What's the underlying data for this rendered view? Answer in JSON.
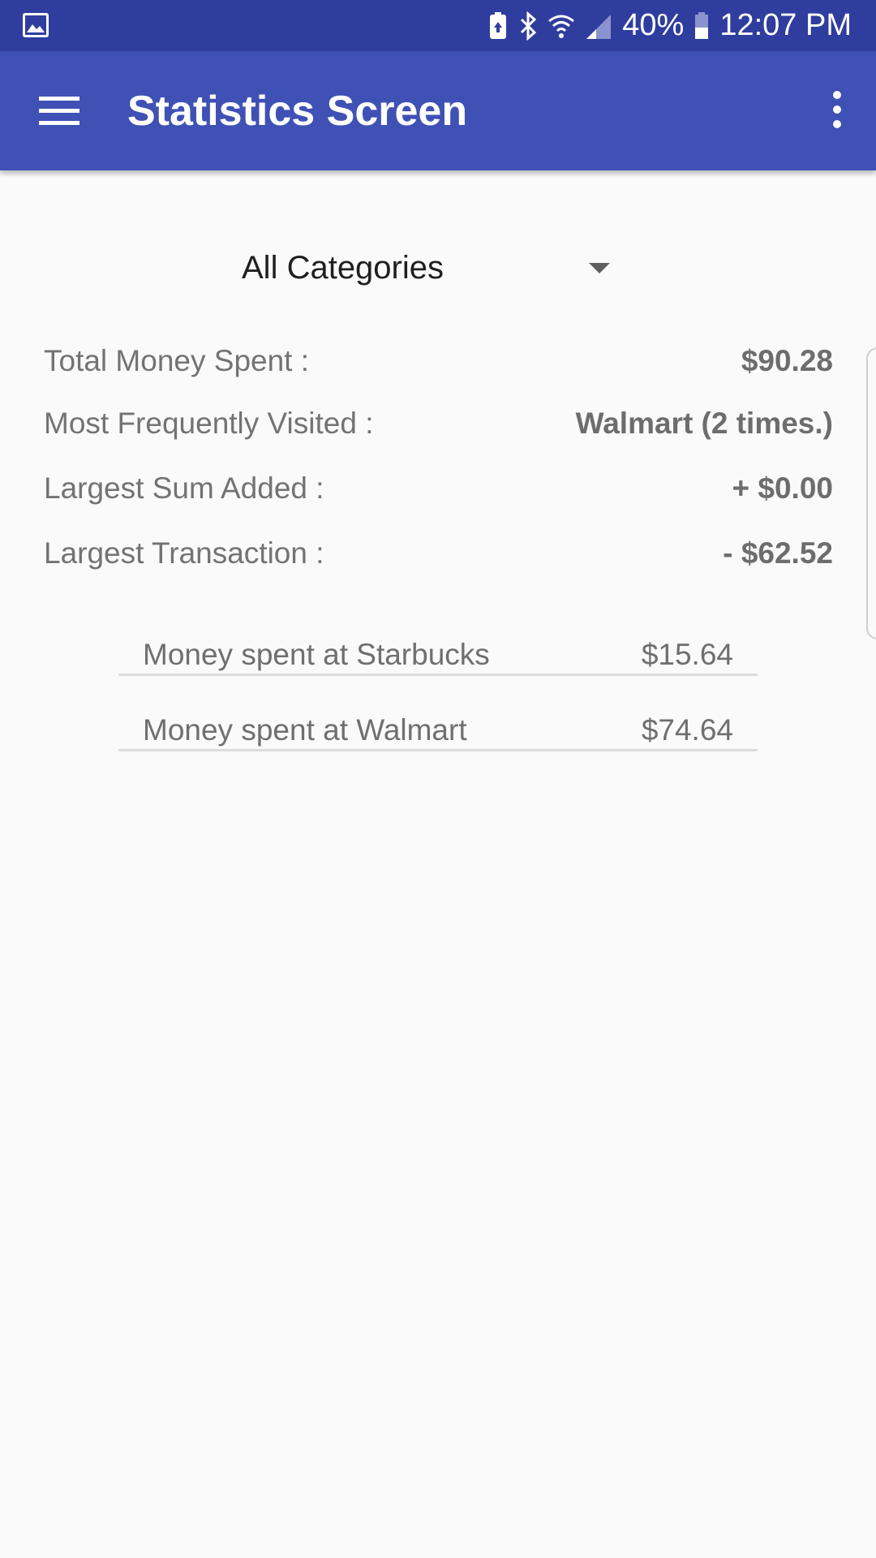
{
  "status_bar": {
    "battery_percent": "40%",
    "time": "12:07 PM",
    "icons": [
      "gallery-icon",
      "battery-saver-icon",
      "bluetooth-icon",
      "wifi-icon",
      "signal-icon",
      "battery-icon"
    ]
  },
  "app_bar": {
    "title": "Statistics Screen",
    "icons": [
      "menu-icon",
      "more-vert-icon"
    ]
  },
  "category_spinner": {
    "selected": "All Categories"
  },
  "stats": [
    {
      "label": "Total Money Spent :",
      "value": "$90.28"
    },
    {
      "label": "Most Frequently Visited :",
      "value": "Walmart (2 times.)"
    },
    {
      "label": "Largest Sum Added :",
      "value": "+ $0.00"
    },
    {
      "label": "Largest Transaction :",
      "value": "- $62.52"
    }
  ],
  "spending": [
    {
      "label": "Money spent at Starbucks",
      "amount": "$15.64"
    },
    {
      "label": "Money spent at Walmart",
      "amount": "$74.64"
    }
  ],
  "colors": {
    "status_bar": "#2f3d9e",
    "app_bar": "#3f51b5",
    "background": "#fafafa"
  }
}
